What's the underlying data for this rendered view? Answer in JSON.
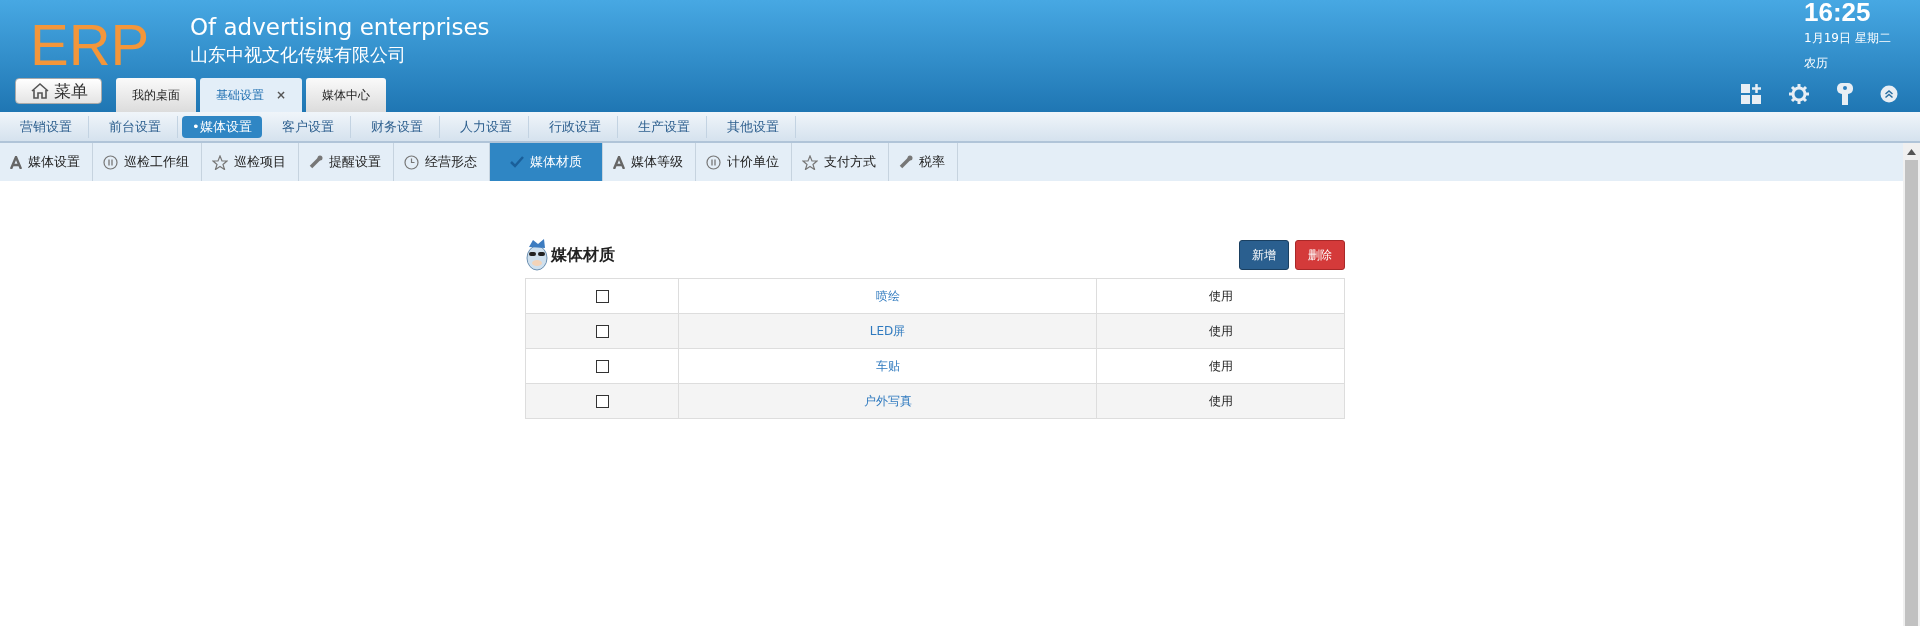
{
  "brand": {
    "logo": "ERP",
    "tagline": "Of advertising enterprises",
    "company": "山东中视文化传媒有限公司"
  },
  "clock": {
    "time": "16:25",
    "date": "1月19日 星期二",
    "lunar": "农历"
  },
  "menu_button": {
    "label": "菜单"
  },
  "window_tabs": [
    {
      "label": "我的桌面",
      "selected": false
    },
    {
      "label": "基础设置",
      "selected": true,
      "close": "×"
    },
    {
      "label": "媒体中心",
      "selected": false
    }
  ],
  "nav": [
    {
      "label": "营销设置",
      "selected": false
    },
    {
      "label": "前台设置",
      "selected": false
    },
    {
      "label": "•媒体设置",
      "selected": true
    },
    {
      "label": "客户设置",
      "selected": false
    },
    {
      "label": "财务设置",
      "selected": false
    },
    {
      "label": "人力设置",
      "selected": false
    },
    {
      "label": "行政设置",
      "selected": false
    },
    {
      "label": "生产设置",
      "selected": false
    },
    {
      "label": "其他设置",
      "selected": false
    }
  ],
  "subtabs": [
    {
      "label": "媒体设置",
      "kind": "letter",
      "selected": false
    },
    {
      "label": "巡检工作组",
      "kind": "pause",
      "selected": false
    },
    {
      "label": "巡检项目",
      "kind": "star",
      "selected": false
    },
    {
      "label": "提醒设置",
      "kind": "wrench",
      "selected": false
    },
    {
      "label": "经营形态",
      "kind": "clock",
      "selected": false
    },
    {
      "label": "媒体材质",
      "kind": "check",
      "selected": true
    },
    {
      "label": "媒体等级",
      "kind": "letter",
      "selected": false
    },
    {
      "label": "计价单位",
      "kind": "pause",
      "selected": false
    },
    {
      "label": "支付方式",
      "kind": "star",
      "selected": false
    },
    {
      "label": "税率",
      "kind": "wrench",
      "selected": false
    }
  ],
  "panel": {
    "title": "媒体材质",
    "buttons": [
      {
        "label": "新增",
        "kind": "primary"
      },
      {
        "label": "删除",
        "kind": "danger"
      }
    ],
    "rows": [
      {
        "checked": false,
        "name": "喷绘",
        "status": "使用"
      },
      {
        "checked": false,
        "name": "LED屏",
        "status": "使用"
      },
      {
        "checked": false,
        "name": "车贴",
        "status": "使用"
      },
      {
        "checked": false,
        "name": "户外写真",
        "status": "使用"
      }
    ]
  }
}
